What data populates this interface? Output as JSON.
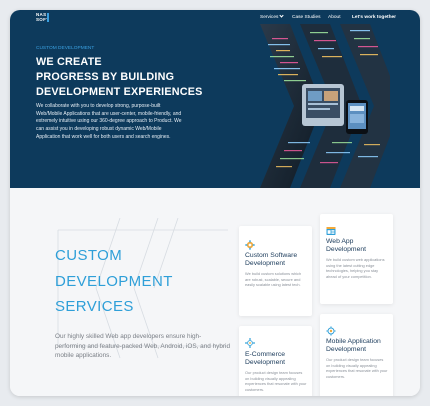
{
  "nav": {
    "logo_line1": "NAS",
    "logo_line2": "SOFT",
    "items": [
      "Services",
      "Case Studies",
      "About"
    ],
    "cta": "Let's work together"
  },
  "hero": {
    "eyebrow": "CUSTOM DEVELOPMENT",
    "title_lines": [
      "WE CREATE",
      "PROGRESS BY BUILDING",
      "DEVELOPMENT EXPERIENCES"
    ],
    "description": "We collaborate with you to develop strong, purpose-built Web/Mobile Applications that are user-center, mobile-friendly, and extremely intuitive using our 360-degree approach to Product. We can assist you in developing robust dynamic Web/Mobile Application that work well for both users and search engines."
  },
  "services": {
    "title_lines": [
      "CUSTOM",
      "DEVELOPMENT",
      "SERVICES"
    ],
    "description": "Our highly skilled Web app developers ensure high-performing and feature-packed Web, Android, iOS, and hybrid mobile applications."
  },
  "cards": [
    {
      "icon": "custom-software-icon",
      "title": "Custom Software Development",
      "text": "We build custom solutions which are robust, scalable, secure and easily scalable using latest tech."
    },
    {
      "icon": "web-app-icon",
      "title": "Web App Development",
      "text": "We build custom web applications using the latest cutting edge technologies, helping you stay ahead of your competition."
    },
    {
      "icon": "ecommerce-icon",
      "title": "E-Commerce Development",
      "text": "Our product design team focuses on building visually appealing experiences that resonate with your customers."
    },
    {
      "icon": "mobile-app-icon",
      "title": "Mobile Application Development",
      "text": "Our product design team focuses on building visually appealing experiences that resonate with your customers."
    }
  ],
  "colors": {
    "hero_bg": "#0d3a5c",
    "accent": "#2e9fd8",
    "page_bg": "#f5f6f8"
  }
}
